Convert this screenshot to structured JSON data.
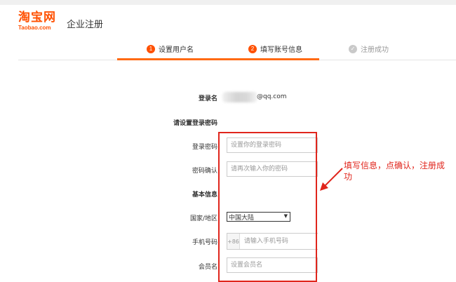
{
  "header": {
    "logo_cn": "淘宝网",
    "logo_en": "Taobao.com",
    "page_title": "企业注册"
  },
  "steps": [
    {
      "num": "1",
      "label": "设置用户名",
      "state": "done"
    },
    {
      "num": "2",
      "label": "填写账号信息",
      "state": "active"
    },
    {
      "num": "",
      "label": "注册成功",
      "state": "inactive"
    }
  ],
  "form": {
    "login_name_label": "登录名",
    "login_name_value": "@qq.com",
    "password_section_label": "请设置登录密码",
    "password_label": "登录密码",
    "password_placeholder": "设置你的登录密码",
    "confirm_label": "密码确认",
    "confirm_placeholder": "请再次输入你的密码",
    "basic_info_label": "基本信息",
    "country_label": "国家/地区",
    "country_value": "中国大陆",
    "phone_label": "手机号码",
    "phone_code": "+86",
    "phone_placeholder": "请输入手机号码",
    "member_label": "会员名",
    "member_placeholder": "设置会员名"
  },
  "annotation": {
    "text": "填写信息，点确认，注册成功",
    "color": "#e0251c"
  },
  "colors": {
    "brand": "#ff5000",
    "highlight": "#e0251c"
  }
}
